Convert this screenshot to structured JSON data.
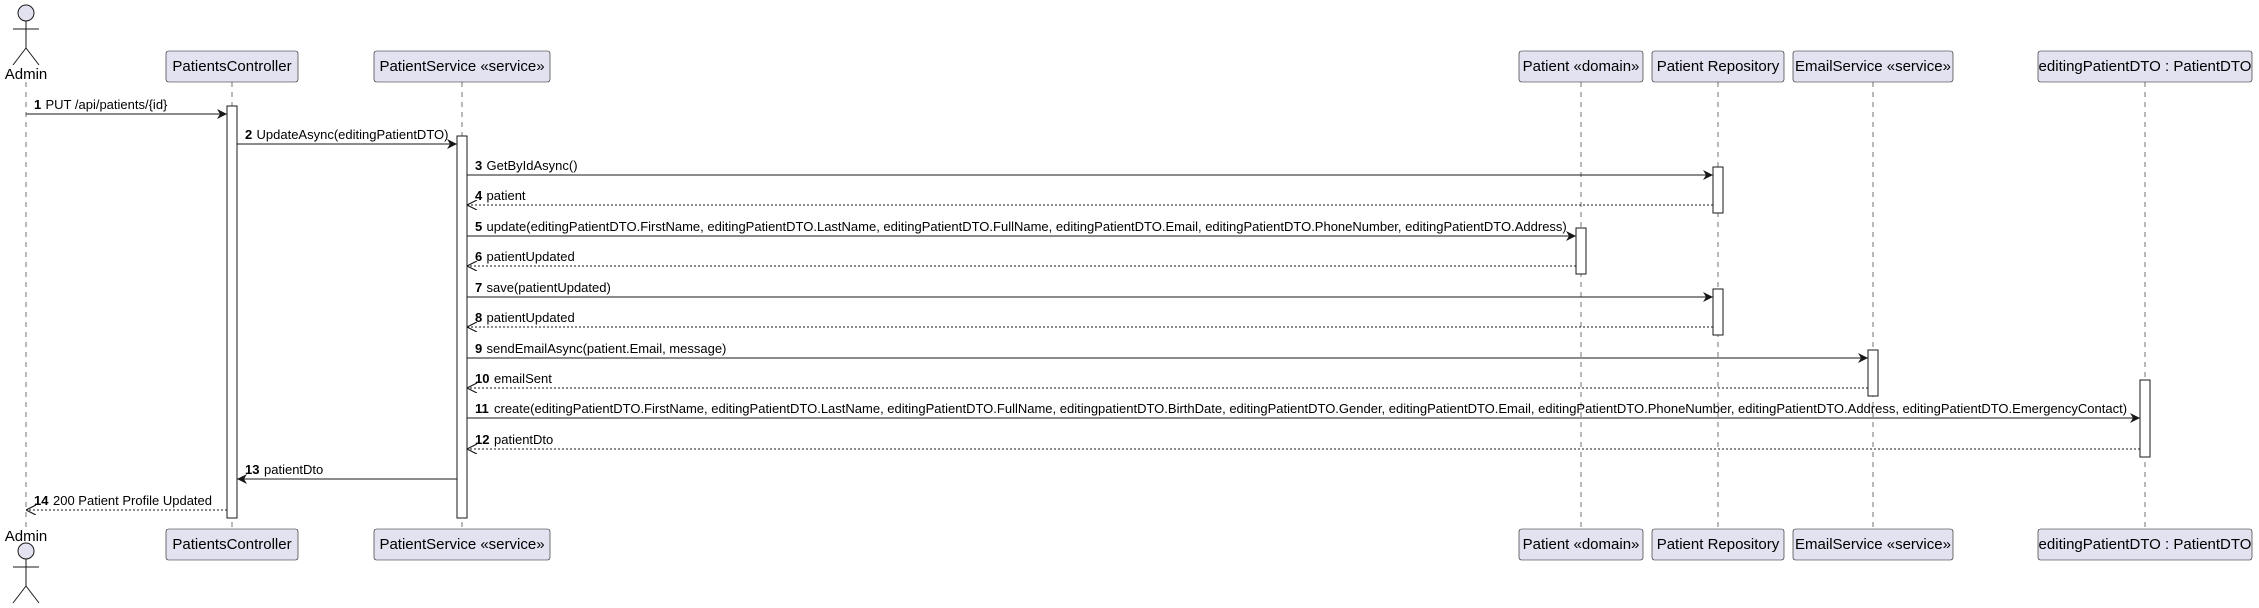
{
  "colors": {
    "participant_fill": "#E2E2F0",
    "participant_stroke": "#181818",
    "lifeline": "#181818",
    "arrow": "#181818",
    "activation_fill": "#FFFFFF"
  },
  "participants": [
    {
      "id": "admin",
      "label": "Admin",
      "kind": "actor"
    },
    {
      "id": "controller",
      "label": "PatientsController",
      "kind": "box"
    },
    {
      "id": "service",
      "label": "PatientService «service»",
      "kind": "box"
    },
    {
      "id": "patient",
      "label": "Patient «domain»",
      "kind": "box"
    },
    {
      "id": "repo",
      "label": "Patient Repository",
      "kind": "box"
    },
    {
      "id": "email",
      "label": "EmailService «service»",
      "kind": "box"
    },
    {
      "id": "dto",
      "label": "editingPatientDTO : PatientDTO",
      "kind": "box"
    }
  ],
  "messages": [
    {
      "num": "1",
      "from": "admin",
      "to": "controller",
      "type": "sync",
      "text": "PUT /api/patients/{id}"
    },
    {
      "num": "2",
      "from": "controller",
      "to": "service",
      "type": "sync",
      "text": "UpdateAsync(editingPatientDTO)"
    },
    {
      "num": "3",
      "from": "service",
      "to": "repo",
      "type": "sync",
      "text": "GetByIdAsync()"
    },
    {
      "num": "4",
      "from": "repo",
      "to": "service",
      "type": "return",
      "text": "patient"
    },
    {
      "num": "5",
      "from": "service",
      "to": "patient",
      "type": "sync",
      "text": "update(editingPatientDTO.FirstName, editingPatientDTO.LastName, editingPatientDTO.FullName, editingPatientDTO.Email, editingPatientDTO.PhoneNumber, editingPatientDTO.Address)"
    },
    {
      "num": "6",
      "from": "patient",
      "to": "service",
      "type": "return",
      "text": "patientUpdated"
    },
    {
      "num": "7",
      "from": "service",
      "to": "repo",
      "type": "sync",
      "text": "save(patientUpdated)"
    },
    {
      "num": "8",
      "from": "repo",
      "to": "service",
      "type": "return",
      "text": "patientUpdated"
    },
    {
      "num": "9",
      "from": "service",
      "to": "email",
      "type": "sync",
      "text": "sendEmailAsync(patient.Email, message)"
    },
    {
      "num": "10",
      "from": "email",
      "to": "service",
      "type": "return",
      "text": "emailSent"
    },
    {
      "num": "11",
      "from": "service",
      "to": "dto",
      "type": "sync",
      "text": "create(editingPatientDTO.FirstName, editingPatientDTO.LastName, editingPatientDTO.FullName, editingpatientDTO.BirthDate, editingPatientDTO.Gender, editingPatientDTO.Email, editingPatientDTO.PhoneNumber, editingPatientDTO.Address, editingPatientDTO.EmergencyContact)"
    },
    {
      "num": "12",
      "from": "dto",
      "to": "service",
      "type": "return",
      "text": "patientDto"
    },
    {
      "num": "13",
      "from": "service",
      "to": "controller",
      "type": "sync",
      "text": "patientDto"
    },
    {
      "num": "14",
      "from": "controller",
      "to": "admin",
      "type": "return",
      "text": "200 Patient Profile Updated"
    }
  ]
}
